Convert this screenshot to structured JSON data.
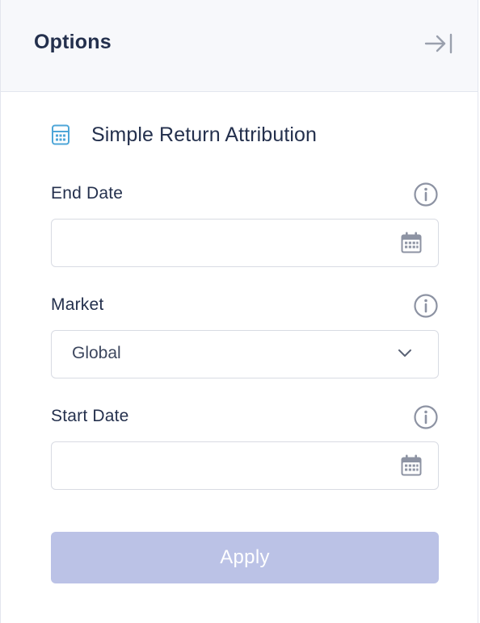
{
  "header": {
    "title": "Options",
    "collapse_icon": "collapse-right-icon"
  },
  "section": {
    "icon": "calculator-icon",
    "title": "Simple Return Attribution"
  },
  "fields": {
    "end_date": {
      "label": "End Date",
      "value": "",
      "icon": "calendar-icon"
    },
    "market": {
      "label": "Market",
      "value": "Global",
      "icon": "chevron-down-icon"
    },
    "start_date": {
      "label": "Start Date",
      "value": "",
      "icon": "calendar-icon"
    }
  },
  "apply": {
    "label": "Apply",
    "disabled": true
  },
  "colors": {
    "text": "#24304d",
    "icon_gray": "#8d93a3",
    "accent_icon": "#4ea6d8",
    "apply_disabled_bg": "#bbc2e6",
    "border": "#d8dbe3",
    "header_bg": "#f7f8fb"
  }
}
